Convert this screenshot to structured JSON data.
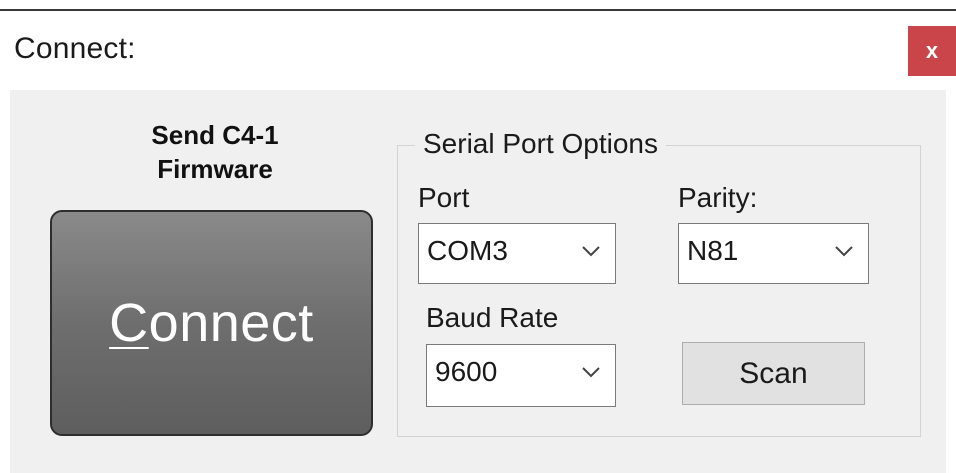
{
  "window": {
    "title": "Connect:",
    "close_glyph": "x"
  },
  "firmware_label": {
    "line1": "Send C4-1",
    "line2": "Firmware"
  },
  "connect_button": {
    "mnemonic": "C",
    "rest": "onnect"
  },
  "serial_port_options": {
    "group_title": "Serial Port Options",
    "port": {
      "label": "Port",
      "value": "COM3"
    },
    "parity": {
      "label": "Parity:",
      "value": "N81"
    },
    "baud_rate": {
      "label": "Baud Rate",
      "value": "9600"
    },
    "scan_label": "Scan"
  },
  "icons": {
    "dropdown": "chevron-down-icon",
    "close": "close-icon"
  },
  "colors": {
    "close_button_bg": "#c9454a",
    "dialog_bg": "#f0f0f0",
    "connect_button_bg": "#6e6e6e",
    "scan_button_bg": "#e1e1e1"
  }
}
